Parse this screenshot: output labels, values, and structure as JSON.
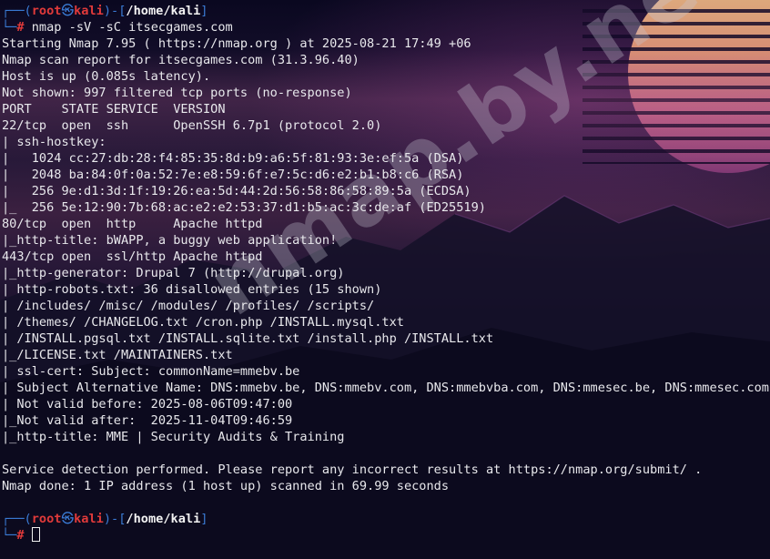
{
  "prompt": {
    "user": "root",
    "host": "kali",
    "cwd": "/home/kali",
    "symbol": "#",
    "at": "㉿"
  },
  "command": "nmap -sV -sC itsecgames.com",
  "output_lines": [
    "Starting Nmap 7.95 ( https://nmap.org ) at 2025-08-21 17:49 +06",
    "Nmap scan report for itsecgames.com (31.3.96.40)",
    "Host is up (0.085s latency).",
    "Not shown: 997 filtered tcp ports (no-response)",
    "PORT    STATE SERVICE  VERSION",
    "22/tcp  open  ssh      OpenSSH 6.7p1 (protocol 2.0)",
    "| ssh-hostkey:",
    "|   1024 cc:27:db:28:f4:85:35:8d:b9:a6:5f:81:93:3e:ef:5a (DSA)",
    "|   2048 ba:84:0f:0a:52:7e:e8:59:6f:e7:5c:d6:e2:b1:b8:c6 (RSA)",
    "|   256 9e:d1:3d:1f:19:26:ea:5d:44:2d:56:58:86:58:89:5a (ECDSA)",
    "|_  256 5e:12:90:7b:68:ac:e2:e2:53:37:d1:b5:ac:3c:de:af (ED25519)",
    "80/tcp  open  http     Apache httpd",
    "|_http-title: bWAPP, a buggy web application!",
    "443/tcp open  ssl/http Apache httpd",
    "|_http-generator: Drupal 7 (http://drupal.org)",
    "| http-robots.txt: 36 disallowed entries (15 shown)",
    "| /includes/ /misc/ /modules/ /profiles/ /scripts/",
    "| /themes/ /CHANGELOG.txt /cron.php /INSTALL.mysql.txt",
    "| /INSTALL.pgsql.txt /INSTALL.sqlite.txt /install.php /INSTALL.txt",
    "|_/LICENSE.txt /MAINTAINERS.txt",
    "| ssl-cert: Subject: commonName=mmebv.be",
    "| Subject Alternative Name: DNS:mmebv.be, DNS:mmebv.com, DNS:mmebvba.com, DNS:mmesec.be, DNS:mmesec.com, D",
    "| Not valid before: 2025-08-06T09:47:00",
    "|_Not valid after:  2025-11-04T09:46:59",
    "|_http-title: MME | Security Audits & Training",
    "",
    "Service detection performed. Please report any incorrect results at https://nmap.org/submit/ .",
    "Nmap done: 1 IP address (1 host up) scanned in 69.99 seconds",
    ""
  ],
  "watermark": "nmap.by.net",
  "colors": {
    "prompt_frame": "#3a7bd5",
    "prompt_user": "#e03a3a",
    "text": "#e8e8ec"
  }
}
